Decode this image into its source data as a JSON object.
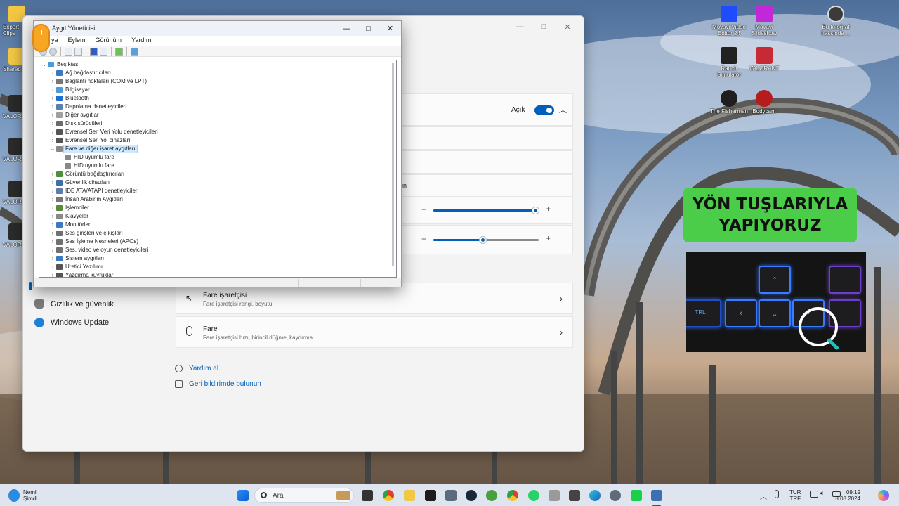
{
  "desktop": {
    "left_icons": [
      "Export Clips",
      "Shared C",
      "VALORA",
      "VALORA",
      "VALORA",
      "VALORA"
    ],
    "right_icons": [
      {
        "label": "Movavi Video Editor 24",
        "color": "#1f4cff"
      },
      {
        "label": "Movavi Slideshow",
        "color": "#c228d8"
      },
      {
        "label": "Bu fotoğraf hakkında ...",
        "color": "#3b3b3b"
      },
      {
        "label": "Ranch Simulator",
        "color": "#222222"
      },
      {
        "label": "VALORANT",
        "color": "#c72a35"
      },
      {
        "label": "The Fisherman",
        "color": "#1e1e1e"
      },
      {
        "label": "Bodycam",
        "color": "#b71c1c"
      }
    ]
  },
  "settings": {
    "toggle_label": "Açık",
    "partial_text": "un",
    "slider1_value": 0.97,
    "slider2_value": 0.47,
    "nav": [
      {
        "label": "Gizlilik ve güvenlik",
        "icon": "shield-icon"
      },
      {
        "label": "Windows Update",
        "icon": "update-icon"
      }
    ],
    "cards": [
      {
        "title": "Fare işaretçisi",
        "subtitle": "Fare işaretçisi rengi, boyutu",
        "icon": "pointer-icon"
      },
      {
        "title": "Fare",
        "subtitle": "Fare işaretçisi hızı, birincil düğme, kaydırma",
        "icon": "mouse-icon"
      }
    ],
    "links": [
      {
        "label": "Yardım al",
        "icon": "help-icon"
      },
      {
        "label": "Geri bildirimde bulunun",
        "icon": "feedback-icon"
      }
    ]
  },
  "device_manager": {
    "title": "Aygıt Yöneticisi",
    "menu": [
      "ya",
      "Eylem",
      "Görünüm",
      "Yardım"
    ],
    "root": "Beşiktaş",
    "items": [
      {
        "label": "Ağ bağdaştırıcıları",
        "expanded": false,
        "color": "#3a78c2"
      },
      {
        "label": "Bağlantı noktaları (COM ve LPT)",
        "expanded": false,
        "color": "#777777"
      },
      {
        "label": "Bilgisayar",
        "expanded": false,
        "color": "#4d9ad8"
      },
      {
        "label": "Bluetooth",
        "expanded": false,
        "color": "#1d6fd6"
      },
      {
        "label": "Depolama denetleyicileri",
        "expanded": false,
        "color": "#5a7fa8"
      },
      {
        "label": "Diğer aygıtlar",
        "expanded": false,
        "color": "#a0a0a0"
      },
      {
        "label": "Disk sürücüleri",
        "expanded": false,
        "color": "#6a6a6a"
      },
      {
        "label": "Evrensel Seri Veri Yolu denetleyicileri",
        "expanded": false,
        "color": "#555555"
      },
      {
        "label": "Evrensel Seri Yol cihazları",
        "expanded": false,
        "color": "#555555"
      },
      {
        "label": "Fare ve diğer işaret aygıtları",
        "expanded": true,
        "selected": true,
        "color": "#888888"
      },
      {
        "label": "HID uyumlu fare",
        "child": true,
        "color": "#888888"
      },
      {
        "label": "HID uyumlu fare",
        "child": true,
        "color": "#888888"
      },
      {
        "label": "Görüntü bağdaştırıcıları",
        "expanded": false,
        "color": "#4f8f3a"
      },
      {
        "label": "Güvenlik cihazları",
        "expanded": false,
        "color": "#3f6fa8"
      },
      {
        "label": "IDE ATA/ATAPI denetleyicileri",
        "expanded": false,
        "color": "#5a7fa8"
      },
      {
        "label": "İnsan Arabirim Aygıtları",
        "expanded": false,
        "color": "#777777"
      },
      {
        "label": "İşlemciler",
        "expanded": false,
        "color": "#5b8a3a"
      },
      {
        "label": "Klavyeler",
        "expanded": false,
        "color": "#8a8a8a"
      },
      {
        "label": "Monitörler",
        "expanded": false,
        "color": "#3a78c2"
      },
      {
        "label": "Ses girişleri ve çıkışları",
        "expanded": false,
        "color": "#707070"
      },
      {
        "label": "Ses İşleme Nesneleri (APOs)",
        "expanded": false,
        "color": "#707070"
      },
      {
        "label": "Ses, video ve oyun denetleyicileri",
        "expanded": false,
        "color": "#707070"
      },
      {
        "label": "Sistem aygıtları",
        "expanded": false,
        "color": "#3a78c2"
      },
      {
        "label": "Üretici Yazılımı",
        "expanded": false,
        "color": "#555555"
      },
      {
        "label": "Yazdırma kuyrukları",
        "expanded": false,
        "color": "#555555"
      }
    ]
  },
  "overlay": {
    "banner_text": "YÖN TUŞLARIYLA\nYAPIYORUZ"
  },
  "taskbar": {
    "weather_temp": "Nemli",
    "weather_sub": "Şimdi",
    "search_placeholder": "Ara",
    "lang_top": "TUR",
    "lang_bottom": "TRF",
    "time": "09:19",
    "date": "8.08.2024"
  }
}
